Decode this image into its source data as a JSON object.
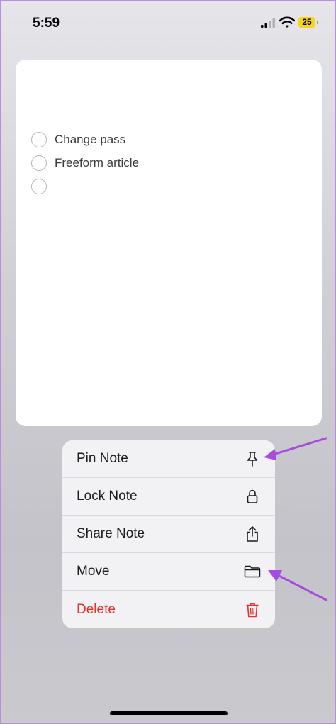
{
  "status_bar": {
    "time": "5:59",
    "battery_level": "25",
    "battery_color": "#f7d51d"
  },
  "note": {
    "checklist": [
      {
        "text": "Change pass",
        "checked": false
      },
      {
        "text": "Freeform article",
        "checked": false
      },
      {
        "text": "",
        "checked": false
      }
    ]
  },
  "context_menu": {
    "items": [
      {
        "label": "Pin Note",
        "icon": "pin-icon"
      },
      {
        "label": "Lock Note",
        "icon": "lock-icon"
      },
      {
        "label": "Share Note",
        "icon": "share-icon"
      },
      {
        "label": "Move",
        "icon": "folder-icon"
      },
      {
        "label": "Delete",
        "icon": "trash-icon",
        "color": "#e0342b"
      }
    ]
  },
  "annotations": {
    "arrow_color": "#a64ce0"
  }
}
